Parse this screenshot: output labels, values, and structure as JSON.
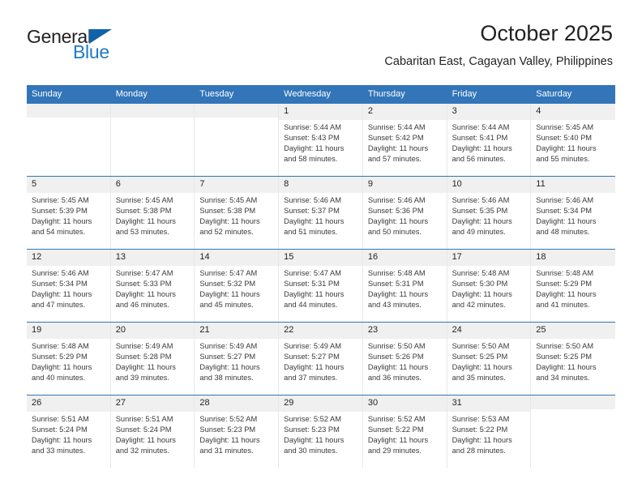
{
  "brand": {
    "name_top": "General",
    "name_bottom": "Blue",
    "triangle_color": "#1063a8",
    "blue_color": "#1f7ac4"
  },
  "header": {
    "title": "October 2025",
    "subtitle": "Cabaritan East, Cagayan Valley, Philippines"
  },
  "theme": {
    "header_blue": "#3275b8",
    "daynum_gray": "#f0f0f0",
    "text": "#231f20"
  },
  "weekdays": [
    "Sunday",
    "Monday",
    "Tuesday",
    "Wednesday",
    "Thursday",
    "Friday",
    "Saturday"
  ],
  "weeks": [
    [
      {
        "day": "",
        "lines": []
      },
      {
        "day": "",
        "lines": []
      },
      {
        "day": "",
        "lines": []
      },
      {
        "day": "1",
        "lines": [
          "Sunrise: 5:44 AM",
          "Sunset: 5:43 PM",
          "Daylight: 11 hours",
          "and 58 minutes."
        ]
      },
      {
        "day": "2",
        "lines": [
          "Sunrise: 5:44 AM",
          "Sunset: 5:42 PM",
          "Daylight: 11 hours",
          "and 57 minutes."
        ]
      },
      {
        "day": "3",
        "lines": [
          "Sunrise: 5:44 AM",
          "Sunset: 5:41 PM",
          "Daylight: 11 hours",
          "and 56 minutes."
        ]
      },
      {
        "day": "4",
        "lines": [
          "Sunrise: 5:45 AM",
          "Sunset: 5:40 PM",
          "Daylight: 11 hours",
          "and 55 minutes."
        ]
      }
    ],
    [
      {
        "day": "5",
        "lines": [
          "Sunrise: 5:45 AM",
          "Sunset: 5:39 PM",
          "Daylight: 11 hours",
          "and 54 minutes."
        ]
      },
      {
        "day": "6",
        "lines": [
          "Sunrise: 5:45 AM",
          "Sunset: 5:38 PM",
          "Daylight: 11 hours",
          "and 53 minutes."
        ]
      },
      {
        "day": "7",
        "lines": [
          "Sunrise: 5:45 AM",
          "Sunset: 5:38 PM",
          "Daylight: 11 hours",
          "and 52 minutes."
        ]
      },
      {
        "day": "8",
        "lines": [
          "Sunrise: 5:46 AM",
          "Sunset: 5:37 PM",
          "Daylight: 11 hours",
          "and 51 minutes."
        ]
      },
      {
        "day": "9",
        "lines": [
          "Sunrise: 5:46 AM",
          "Sunset: 5:36 PM",
          "Daylight: 11 hours",
          "and 50 minutes."
        ]
      },
      {
        "day": "10",
        "lines": [
          "Sunrise: 5:46 AM",
          "Sunset: 5:35 PM",
          "Daylight: 11 hours",
          "and 49 minutes."
        ]
      },
      {
        "day": "11",
        "lines": [
          "Sunrise: 5:46 AM",
          "Sunset: 5:34 PM",
          "Daylight: 11 hours",
          "and 48 minutes."
        ]
      }
    ],
    [
      {
        "day": "12",
        "lines": [
          "Sunrise: 5:46 AM",
          "Sunset: 5:34 PM",
          "Daylight: 11 hours",
          "and 47 minutes."
        ]
      },
      {
        "day": "13",
        "lines": [
          "Sunrise: 5:47 AM",
          "Sunset: 5:33 PM",
          "Daylight: 11 hours",
          "and 46 minutes."
        ]
      },
      {
        "day": "14",
        "lines": [
          "Sunrise: 5:47 AM",
          "Sunset: 5:32 PM",
          "Daylight: 11 hours",
          "and 45 minutes."
        ]
      },
      {
        "day": "15",
        "lines": [
          "Sunrise: 5:47 AM",
          "Sunset: 5:31 PM",
          "Daylight: 11 hours",
          "and 44 minutes."
        ]
      },
      {
        "day": "16",
        "lines": [
          "Sunrise: 5:48 AM",
          "Sunset: 5:31 PM",
          "Daylight: 11 hours",
          "and 43 minutes."
        ]
      },
      {
        "day": "17",
        "lines": [
          "Sunrise: 5:48 AM",
          "Sunset: 5:30 PM",
          "Daylight: 11 hours",
          "and 42 minutes."
        ]
      },
      {
        "day": "18",
        "lines": [
          "Sunrise: 5:48 AM",
          "Sunset: 5:29 PM",
          "Daylight: 11 hours",
          "and 41 minutes."
        ]
      }
    ],
    [
      {
        "day": "19",
        "lines": [
          "Sunrise: 5:48 AM",
          "Sunset: 5:29 PM",
          "Daylight: 11 hours",
          "and 40 minutes."
        ]
      },
      {
        "day": "20",
        "lines": [
          "Sunrise: 5:49 AM",
          "Sunset: 5:28 PM",
          "Daylight: 11 hours",
          "and 39 minutes."
        ]
      },
      {
        "day": "21",
        "lines": [
          "Sunrise: 5:49 AM",
          "Sunset: 5:27 PM",
          "Daylight: 11 hours",
          "and 38 minutes."
        ]
      },
      {
        "day": "22",
        "lines": [
          "Sunrise: 5:49 AM",
          "Sunset: 5:27 PM",
          "Daylight: 11 hours",
          "and 37 minutes."
        ]
      },
      {
        "day": "23",
        "lines": [
          "Sunrise: 5:50 AM",
          "Sunset: 5:26 PM",
          "Daylight: 11 hours",
          "and 36 minutes."
        ]
      },
      {
        "day": "24",
        "lines": [
          "Sunrise: 5:50 AM",
          "Sunset: 5:25 PM",
          "Daylight: 11 hours",
          "and 35 minutes."
        ]
      },
      {
        "day": "25",
        "lines": [
          "Sunrise: 5:50 AM",
          "Sunset: 5:25 PM",
          "Daylight: 11 hours",
          "and 34 minutes."
        ]
      }
    ],
    [
      {
        "day": "26",
        "lines": [
          "Sunrise: 5:51 AM",
          "Sunset: 5:24 PM",
          "Daylight: 11 hours",
          "and 33 minutes."
        ]
      },
      {
        "day": "27",
        "lines": [
          "Sunrise: 5:51 AM",
          "Sunset: 5:24 PM",
          "Daylight: 11 hours",
          "and 32 minutes."
        ]
      },
      {
        "day": "28",
        "lines": [
          "Sunrise: 5:52 AM",
          "Sunset: 5:23 PM",
          "Daylight: 11 hours",
          "and 31 minutes."
        ]
      },
      {
        "day": "29",
        "lines": [
          "Sunrise: 5:52 AM",
          "Sunset: 5:23 PM",
          "Daylight: 11 hours",
          "and 30 minutes."
        ]
      },
      {
        "day": "30",
        "lines": [
          "Sunrise: 5:52 AM",
          "Sunset: 5:22 PM",
          "Daylight: 11 hours",
          "and 29 minutes."
        ]
      },
      {
        "day": "31",
        "lines": [
          "Sunrise: 5:53 AM",
          "Sunset: 5:22 PM",
          "Daylight: 11 hours",
          "and 28 minutes."
        ]
      },
      {
        "day": "",
        "lines": []
      }
    ]
  ]
}
